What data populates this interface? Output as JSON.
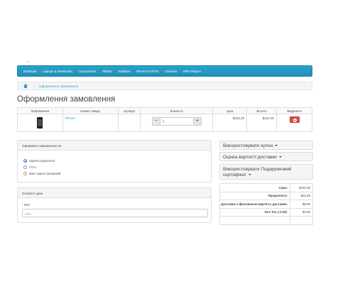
{
  "nav": {
    "items": [
      "Desktops",
      "Laptops & Notebooks",
      "Components",
      "Tablets",
      "Software",
      "Phones & PDAs",
      "Cameras",
      "MP3 Players"
    ]
  },
  "breadcrumb": {
    "home_icon": "home-icon",
    "current": "Оформлення замовлення"
  },
  "page": {
    "title": "Оформлення замовлення"
  },
  "cart": {
    "headers": [
      "Зображення",
      "Назва товару",
      "Артикул",
      "Кількість",
      "Ціна",
      "Всього",
      "Видалити"
    ],
    "rows": [
      {
        "image_icon": "iphone-image",
        "name": "iPhone",
        "model": "",
        "quantity": "1",
        "price": "$123.20",
        "total": "$123.20"
      }
    ],
    "qty_minus": "−",
    "qty_plus": "+"
  },
  "checkout": {
    "options_title": "Оформити замовлення як",
    "options": [
      {
        "label": "Зареєструватися",
        "selected": true
      },
      {
        "label": "Гість",
        "selected": false
      },
      {
        "label": "Вже зареєстрований",
        "selected": false
      }
    ],
    "personal_title": "Особисті дані",
    "name_label": "Ім'я",
    "name_placeholder": "Ім'я"
  },
  "sidebar": {
    "coupon": "Використовувати купон",
    "shipping": "Оцінка вартості доставки",
    "voucher": "Використовувати Подарунковий сертифікат"
  },
  "totals": [
    {
      "label": "Сума:",
      "value": "$101.00"
    },
    {
      "label": "Предоплата:",
      "value": "$23.25"
    },
    {
      "label": "Доставка з фіксованою вартість доставки:",
      "value": "$5.00"
    },
    {
      "label": "Eco Tax (-2.00):",
      "value": "$4.00"
    },
    {
      "label": "",
      "value": ""
    }
  ],
  "colors": {
    "nav": "#23a1d1",
    "link": "#23a1d1",
    "danger": "#da4f49"
  }
}
